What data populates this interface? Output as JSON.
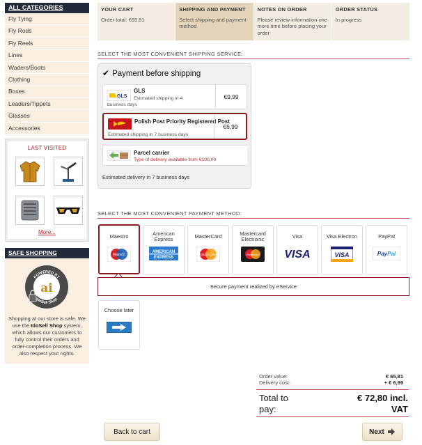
{
  "sidebar": {
    "categories_header": "ALL CATEGORIES",
    "categories": [
      "Fly Tying",
      "Fly Rods",
      "Fly Reels",
      "Lines",
      "Waders/Boots",
      "Clothing",
      "Boxes",
      "Leaders/Tippets",
      "Glasses",
      "Accessories"
    ],
    "last_visited_title": "LAST VISITED",
    "last_visited_icons": [
      "jacket-image",
      "fly-tying-vise-image",
      "fly-box-image",
      "sunglasses-image"
    ],
    "more_link": "More...",
    "safe_header": "SAFE SHOPPING",
    "safe_badge_top": "POWERED BY",
    "safe_badge_bottom": "IdoSell Shop",
    "safe_text_1": "Shopping at our store is safe. We use the ",
    "safe_text_brand": "IdoSell Shop",
    "safe_text_2": " system, which allows our customers to fully control their orders and order-completion process. We also respect your rights."
  },
  "steps": [
    {
      "title": "YOUR CART",
      "text": "Order total: €65,81"
    },
    {
      "title": "SHIPPING AND PAYMENT",
      "text": "Select shipping and payment method"
    },
    {
      "title": "NOTES ON ORDER",
      "text": "Please review information one more time before placing your order"
    },
    {
      "title": "ORDER STATUS",
      "text": "In progress"
    }
  ],
  "shipping": {
    "section_title": "SELECT THE MOST CONVENIENT SHIPPING SERVICE:",
    "group_title": "Payment before shipping",
    "options": [
      {
        "name": "GLS",
        "desc": "Estimated shipping in 4 business days",
        "price": "€9,99",
        "logo": "gls-logo"
      },
      {
        "name": "Polish Post Priority Registered Post",
        "desc": "Estimated shipping in 7 business days",
        "price": "€6,99",
        "logo": "polish-post-logo"
      },
      {
        "name": "Parcel carrier",
        "desc": "Type of delivery available from €100,00",
        "price": "",
        "logo": "parcel-carrier-logo"
      }
    ],
    "estimate": "Estimated delivery in 7 business days"
  },
  "payment": {
    "section_title": "SELECT THE MOST CONVENIENT PAYMENT METHOD:",
    "methods": [
      "Maestro",
      "American Express",
      "MasterCard",
      "Mastercard Electronic",
      "Visa",
      "Visa Electron",
      "PayPal"
    ],
    "secure_text": "Secure payment realized by eService",
    "later_label": "Choose later"
  },
  "summary": {
    "order_value_label": "Order value:",
    "order_value": "€ 65,81",
    "delivery_label": "Delivery cost:",
    "delivery": "+ € 6,99",
    "total_label_1": "Total to",
    "total_label_2": "pay:",
    "total_value_1": "€ 72,80 incl.",
    "total_value_2": "VAT"
  },
  "buttons": {
    "back": "Back to cart",
    "next": "Next"
  },
  "colors": {
    "accent": "#8b1a1f",
    "sidebar_header": "#222a3a",
    "sidebar_bg": "#f9eee0",
    "step_active": "#e4d4b9"
  }
}
